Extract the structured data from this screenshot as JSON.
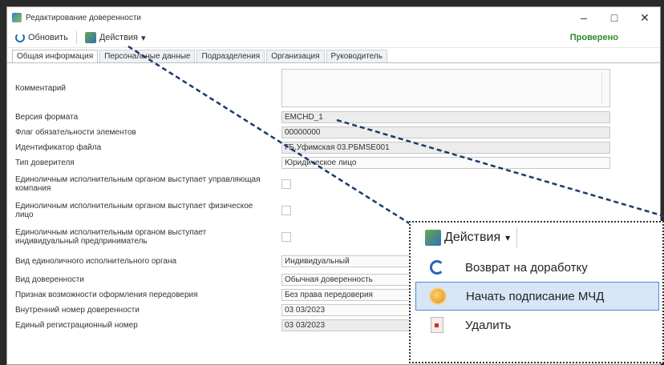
{
  "window": {
    "title": "Редактирование доверенности",
    "controls": [
      "–",
      "□",
      "✕"
    ]
  },
  "toolbar": {
    "refresh_label": "Обновить",
    "actions_label": "Действия",
    "actions_caret": "▾",
    "check_label": "Проверено"
  },
  "tabs": [
    "Общая информация",
    "Персональные данные",
    "Подразделения",
    "Организация",
    "Руководитель"
  ],
  "form": {
    "comment_label": "Комментарий",
    "comment_value": "",
    "format_version_label": "Версия формата",
    "format_version_value": "EMCHD_1",
    "mandatory_flag_label": "Флаг обязательности элементов",
    "mandatory_flag_value": "00000000",
    "file_id_label": "Идентификатор файла",
    "file_id_value": "ГБ.Уфимская 03.РБМSE001",
    "principal_type_label": "Тип доверителя",
    "principal_type_value": "Юридическое лицо",
    "sole_exec_mgmt_label": "Единоличным исполнительным органом выступает управляющая компания",
    "sole_exec_person_label": "Единоличным исполнительным органом выступает физическое лицо",
    "sole_exec_ip_label": "Единоличным исполнительным органом выступает индивидуальный предприниматель",
    "sole_exec_kind_label": "Вид единоличного исполнительного органа",
    "sole_exec_kind_value": "Индивидуальный",
    "poa_kind_label": "Вид доверенности",
    "poa_kind_value": "Обычная доверенность",
    "redelegation_label": "Признак возможности оформления передоверия",
    "redelegation_value": "Без права передоверия",
    "internal_number_label": "Внутренний номер доверенности",
    "internal_number_value": "03 03/2023",
    "registration_number_label": "Единый регистрационный номер",
    "registration_number_value": "03 03/2023"
  },
  "popup": {
    "header_label": "Действия",
    "header_caret": "▾",
    "items": [
      {
        "label": "Возврат на доработку",
        "icon": "undo-icon"
      },
      {
        "label": "Начать подписание МЧД",
        "icon": "sign-icon"
      },
      {
        "label": "Удалить",
        "icon": "trash-icon"
      }
    ],
    "selected_index": 1
  },
  "colors": {
    "accent": "#1f6fc5",
    "check": "#2e8b2e",
    "selection": "#d6e6f7"
  }
}
